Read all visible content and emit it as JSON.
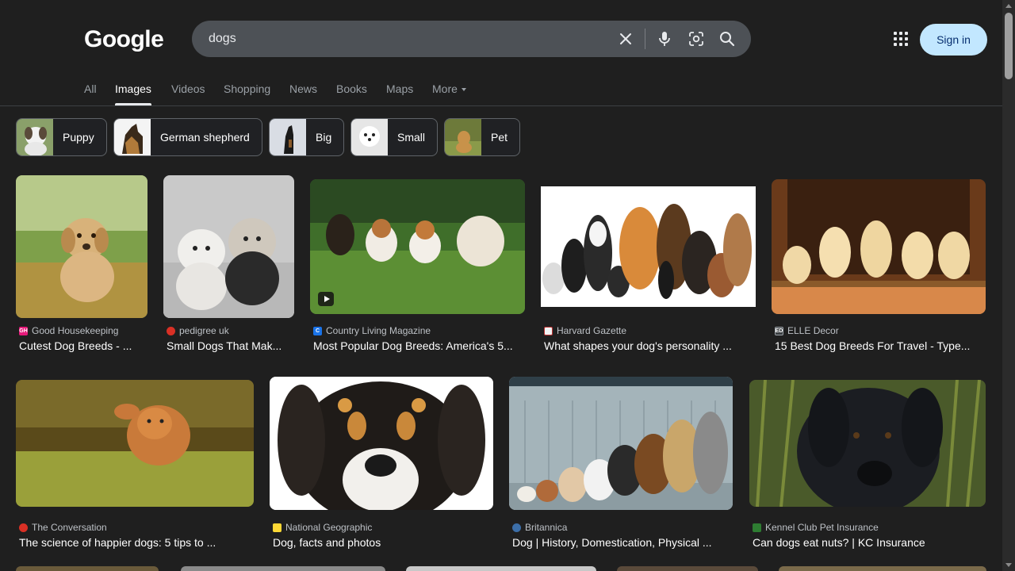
{
  "logo": "Google",
  "search": {
    "query": "dogs"
  },
  "header": {
    "signin_label": "Sign in"
  },
  "tabs": [
    "All",
    "Images",
    "Videos",
    "Shopping",
    "News",
    "Books",
    "Maps",
    "More"
  ],
  "active_tab": "Images",
  "chips": [
    "Puppy",
    "German shepherd",
    "Big",
    "Small",
    "Pet"
  ],
  "results": [
    {
      "source": "Good Housekeeping",
      "title": "Cutest Dog Breeds - ...",
      "favicon_color": "#e6197a",
      "favicon_text": "GH"
    },
    {
      "source": "pedigree uk",
      "title": "Small Dogs That Mak...",
      "favicon_color": "#d93025",
      "favicon_text": ""
    },
    {
      "source": "Country Living Magazine",
      "title": "Most Popular Dog Breeds: America's 5...",
      "favicon_color": "#1a73e8",
      "favicon_text": "C"
    },
    {
      "source": "Harvard Gazette",
      "title": "What shapes your dog's personality ...",
      "favicon_color": "#f1f3f4",
      "favicon_text": ""
    },
    {
      "source": "ELLE Decor",
      "title": "15 Best Dog Breeds For Travel - Type...",
      "favicon_color": "#5f6368",
      "favicon_text": "ED"
    },
    {
      "source": "The Conversation",
      "title": "The science of happier dogs: 5 tips to ...",
      "favicon_color": "#d93025",
      "favicon_text": ""
    },
    {
      "source": "National Geographic",
      "title": "Dog, facts and photos",
      "favicon_color": "#fdd835",
      "favicon_text": ""
    },
    {
      "source": "Britannica",
      "title": "Dog | History, Domestication, Physical ...",
      "favicon_color": "#3c6ea8",
      "favicon_text": ""
    },
    {
      "source": "Kennel Club Pet Insurance",
      "title": "Can dogs eat nuts? | KC Insurance",
      "favicon_color": "#2e7d32",
      "favicon_text": ""
    }
  ],
  "icons": {
    "clear": "close-icon",
    "voice": "mic-icon",
    "lens": "camera-lens-icon",
    "search": "search-icon",
    "apps": "apps-grid-icon",
    "video": "play-icon"
  },
  "colors": {
    "background": "#1f1f1f",
    "searchbar": "#4d5156",
    "signin": "#c2e7ff"
  }
}
